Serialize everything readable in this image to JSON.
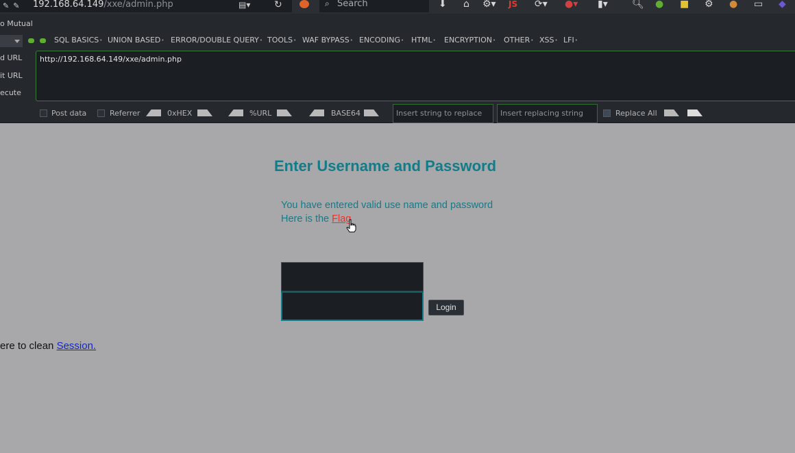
{
  "browser": {
    "url_host": "192.168.64.149",
    "url_path": "/xxe/admin.php",
    "search_placeholder": "Search",
    "toolbar_text_icon": "JS"
  },
  "hackbar": {
    "mutual_text": "o Mutual",
    "menu": [
      "SQL BASICS",
      "UNION BASED",
      "ERROR/DOUBLE QUERY",
      "TOOLS",
      "WAF BYPASS",
      "ENCODING",
      "HTML",
      "ENCRYPTION",
      "OTHER",
      "XSS",
      "LFI"
    ],
    "side_actions": [
      "d URL",
      "it URL",
      "ecute"
    ],
    "url_value": "http://192.168.64.149/xxe/admin.php",
    "post_data_label": "Post data",
    "referrer_label": "Referrer",
    "hex_label": "0xHEX",
    "url_enc_label": "%URL",
    "base64_label": "BASE64",
    "replace_placeholder": "Insert string to replace",
    "replacing_placeholder": "Insert replacing string",
    "replace_all_label": "Replace All"
  },
  "page": {
    "heading": "Enter Username and Password",
    "valid_msg": "You have entered valid use name and password",
    "flag_prefix": "Here is the ",
    "flag_link": "Flag",
    "login_button": "Login",
    "session_prefix": "ere to clean ",
    "session_link": "Session."
  }
}
